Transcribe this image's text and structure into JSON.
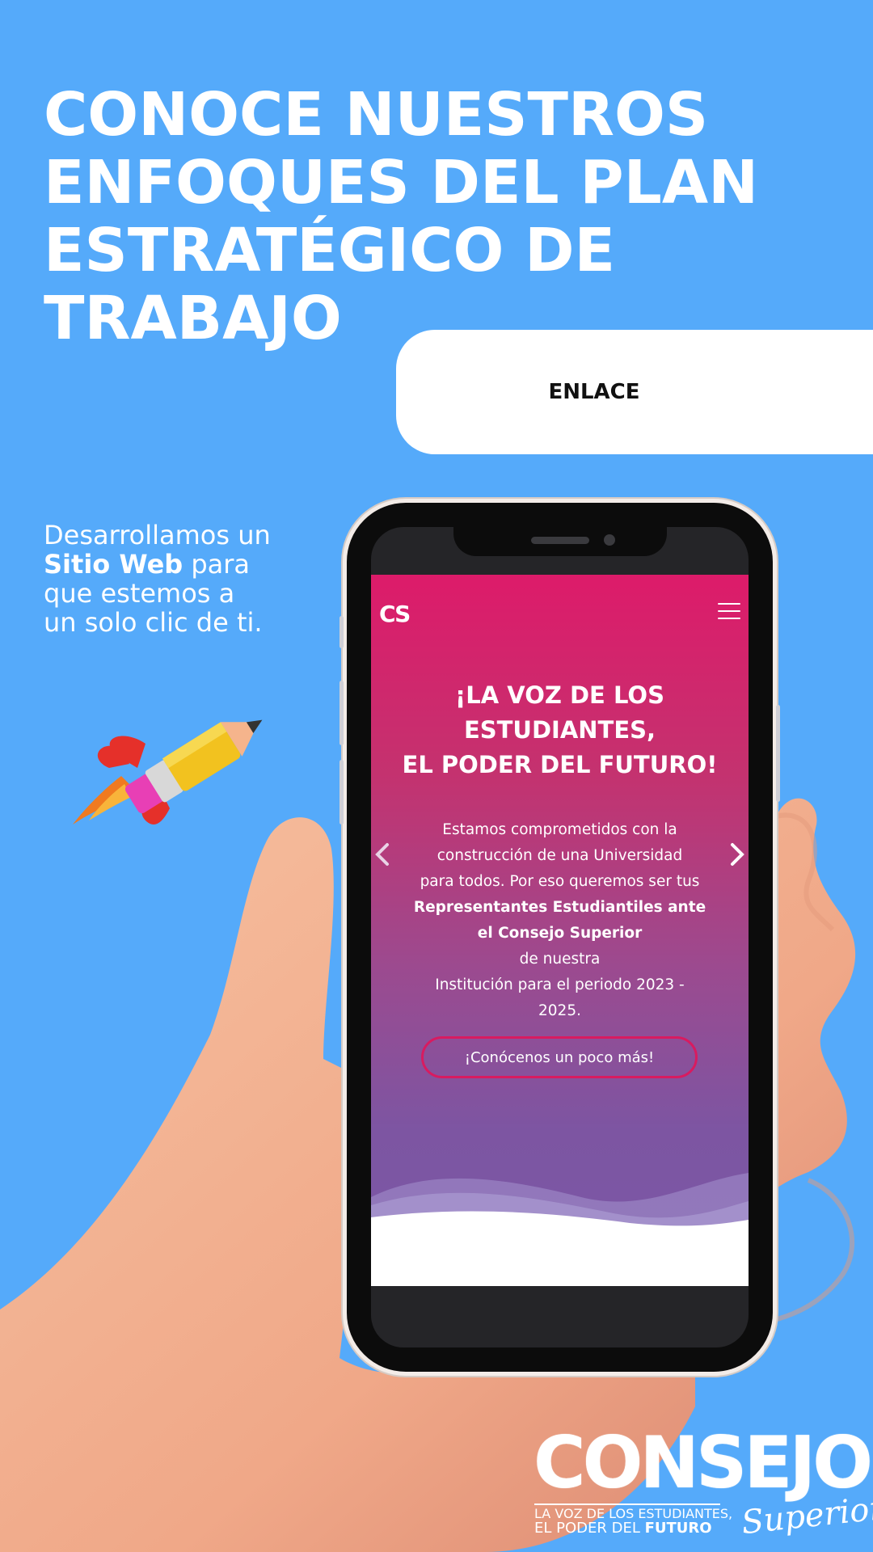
{
  "headline": {
    "line1": "CONOCE NUESTROS",
    "line2": "ENFOQUES DEL PLAN",
    "line3": "ESTRATÉGICO DE",
    "line4": "TRABAJO"
  },
  "link_button": {
    "label": "ENLACE"
  },
  "tagline": {
    "line1": "Desarrollamos un",
    "line2_bold": "Sitio Web",
    "line2_rest": " para",
    "line3": "que estemos a",
    "line4": "un solo clic de ti."
  },
  "phone_site": {
    "logo": "CS",
    "title_line1": "¡LA VOZ DE LOS",
    "title_line2": "ESTUDIANTES,",
    "title_line3": "EL PODER DEL FUTURO!",
    "desc": {
      "l1": "Estamos comprometidos con la",
      "l2": "construcción de una Universidad",
      "l3": "para todos. Por eso queremos ser tus",
      "l4": "Representantes Estudiantiles ante",
      "l5_bold": "el Consejo Superior",
      "l5_rest": " de nuestra",
      "l6": "Institución para el periodo 2023 -",
      "l7": "2025."
    },
    "cta_label": "¡Conócenos un poco más!",
    "colors": {
      "top": "#dd1b6a",
      "bottom": "#7a58a6",
      "cta_border": "#d81b60"
    }
  },
  "brand": {
    "word": "CONSEJO",
    "tag_line1": "LA VOZ DE LOS ESTUDIANTES,",
    "tag_line2_plain": "EL PODER DEL ",
    "tag_line2_bold": "FUTURO",
    "script": "Superior"
  },
  "colors": {
    "background": "#55aafa",
    "text": "#ffffff"
  }
}
